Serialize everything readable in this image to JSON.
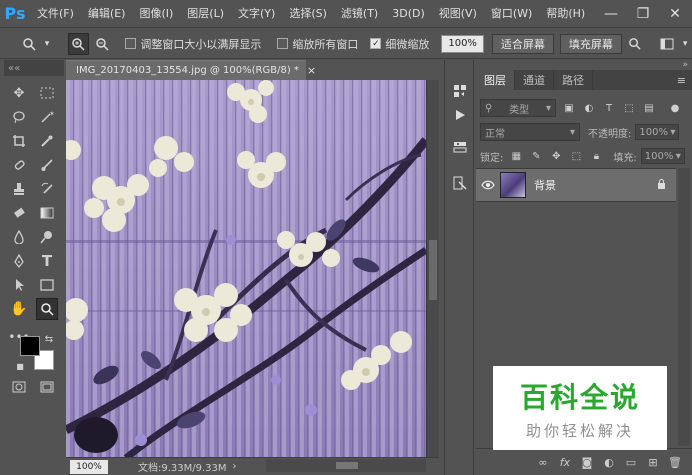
{
  "app": {
    "logo": "Ps"
  },
  "menu": [
    "文件(F)",
    "编辑(E)",
    "图像(I)",
    "图层(L)",
    "文字(Y)",
    "选择(S)",
    "滤镜(T)",
    "3D(D)",
    "视图(V)",
    "窗口(W)",
    "帮助(H)"
  ],
  "window_controls": {
    "minimize": "—",
    "restore": "❐",
    "close": "✕"
  },
  "options": {
    "resize_windows": "调整窗口大小以满屏显示",
    "zoom_all": "缩放所有窗口",
    "scrubby_zoom": "细微缩放",
    "zoom_value": "100%",
    "fit_screen": "适合屏幕",
    "fill_screen": "填充屏幕"
  },
  "toolbar": {
    "collapse": "««"
  },
  "document": {
    "tab_title": "IMG_20170403_13554.jpg @ 100%(RGB/8) *",
    "tab_close": "×",
    "status_zoom": "100%",
    "status_info": "文档:9.33M/9.33M",
    "status_arrow": "›"
  },
  "panel": {
    "collapse": "»",
    "tabs": [
      "图层",
      "通道",
      "路径"
    ],
    "filter_kind": "类型",
    "blend_mode": "正常",
    "opacity_label": "不透明度:",
    "opacity_value": "100%",
    "lock_label": "锁定:",
    "fill_label": "填充:",
    "fill_value": "100%",
    "layer_name": "背景"
  },
  "watermark": {
    "title": "百科全说",
    "subtitle": "助你轻松解决"
  },
  "colors": {
    "ps_blue": "#31a8ff",
    "watermark_green": "#29a82e"
  }
}
